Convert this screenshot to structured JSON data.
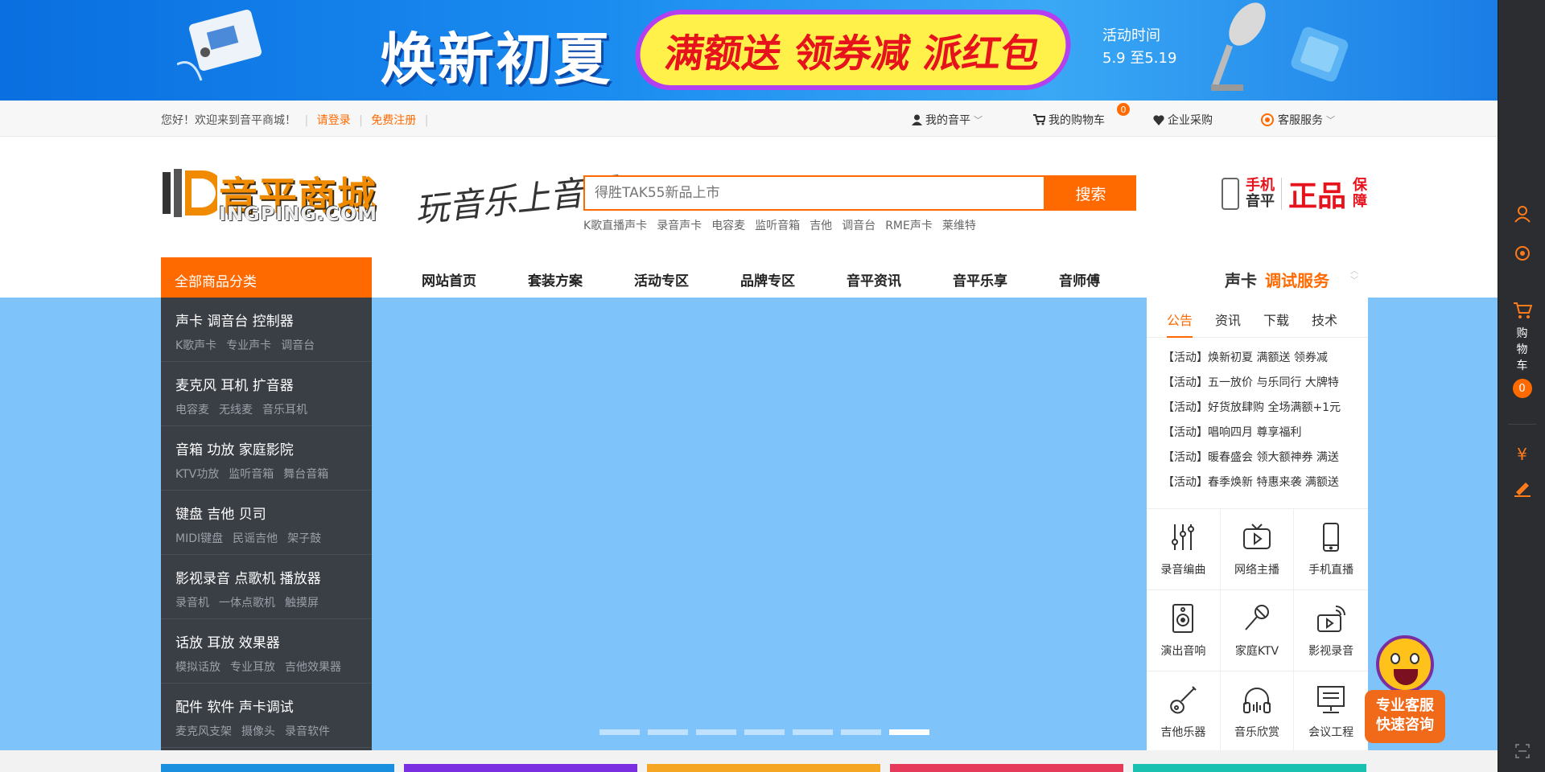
{
  "banner": {
    "title": "焕新初夏",
    "promo": "满额送 领券减 派红包",
    "date_label": "活动时间",
    "date_range": "5.9 至5.19"
  },
  "topbar": {
    "welcome": "您好！欢迎来到音平商城！",
    "login": "请登录",
    "register": "免费注册",
    "my_account": "我的音平",
    "my_cart": "我的购物车",
    "cart_badge": "0",
    "enterprise": "企业采购",
    "service": "客服服务"
  },
  "header": {
    "logo_cn": "音平商城",
    "logo_en": "INGPING.COM",
    "slogan": "玩音乐上音平",
    "search_placeholder": "得胜TAK55新品上市",
    "search_button": "搜索",
    "hotwords": [
      "K歌直播声卡",
      "录音声卡",
      "电容麦",
      "监听音箱",
      "吉他",
      "调音台",
      "RME声卡",
      "莱维特"
    ],
    "badge_mobile_1": "手机",
    "badge_mobile_2": "音平",
    "badge_genuine": "正品",
    "badge_guarantee_1": "保",
    "badge_guarantee_2": "障"
  },
  "nav": {
    "all_categories": "全部商品分类",
    "links": [
      "网站首页",
      "套装方案",
      "活动专区",
      "品牌专区",
      "音平资讯",
      "音平乐享",
      "音师傅"
    ],
    "promo_prefix": "声卡",
    "promo_highlight": "调试服务"
  },
  "categories": [
    {
      "main": "声卡 调音台 控制器",
      "subs": [
        "K歌声卡",
        "专业声卡",
        "调音台"
      ]
    },
    {
      "main": "麦克风 耳机 扩音器",
      "subs": [
        "电容麦",
        "无线麦",
        "音乐耳机"
      ]
    },
    {
      "main": "音箱 功放 家庭影院",
      "subs": [
        "KTV功放",
        "监听音箱",
        "舞台音箱"
      ]
    },
    {
      "main": "键盘 吉他 贝司",
      "subs": [
        "MIDI键盘",
        "民谣吉他",
        "架子鼓"
      ]
    },
    {
      "main": "影视录音 点歌机 播放器",
      "subs": [
        "录音机",
        "一体点歌机",
        "触摸屏"
      ]
    },
    {
      "main": "话放 耳放 效果器",
      "subs": [
        "模拟话放",
        "专业耳放",
        "吉他效果器"
      ]
    },
    {
      "main": "配件 软件 声卡调试",
      "subs": [
        "麦克风支架",
        "摄像头",
        "录音软件"
      ]
    }
  ],
  "notice": {
    "tabs": [
      "公告",
      "资讯",
      "下载",
      "技术"
    ],
    "items": [
      "【活动】焕新初夏 满额送 领券减",
      "【活动】五一放价 与乐同行 大牌特",
      "【活动】好货放肆购 全场满额+1元",
      "【活动】唱响四月 尊享福利",
      "【活动】暖春盛会 领大额神券 满送",
      "【活动】春季焕新 特惠来袭 满额送"
    ]
  },
  "services": [
    {
      "label": "录音编曲",
      "icon": "mixer-sliders-icon"
    },
    {
      "label": "网络主播",
      "icon": "tv-play-icon"
    },
    {
      "label": "手机直播",
      "icon": "mobile-phone-icon"
    },
    {
      "label": "演出音响",
      "icon": "speaker-icon"
    },
    {
      "label": "家庭KTV",
      "icon": "microphone-icon"
    },
    {
      "label": "影视录音",
      "icon": "video-broadcast-icon"
    },
    {
      "label": "吉他乐器",
      "icon": "guitar-icon"
    },
    {
      "label": "音乐欣赏",
      "icon": "headphones-icon"
    },
    {
      "label": "会议工程",
      "icon": "presentation-board-icon"
    }
  ],
  "carousel": {
    "count": 7,
    "active_index": 6
  },
  "rightbar": {
    "cart_label": [
      "购",
      "物",
      "车"
    ],
    "cart_count": "0",
    "money_icon": "¥"
  },
  "float_service": {
    "line1": "专业客服",
    "line2": "快速咨询"
  },
  "colors": {
    "accent": "#ff6a00",
    "hero_bg": "#7fc3fb",
    "sidebar_dark": "#3a3e45"
  }
}
